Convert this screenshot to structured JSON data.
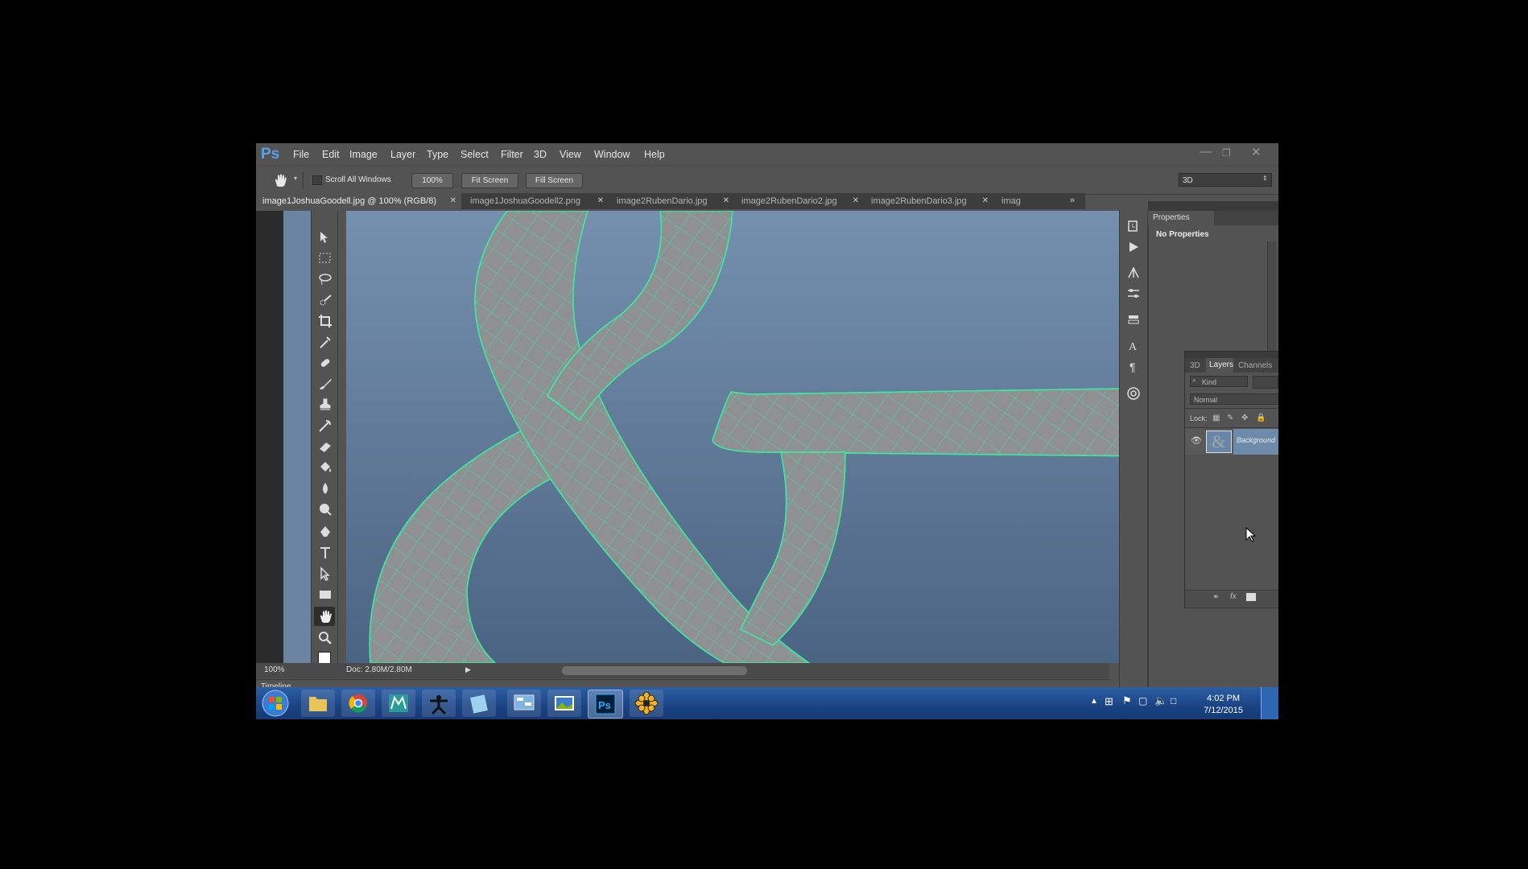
{
  "app": {
    "logo": "Ps",
    "title": "Adobe Photoshop"
  },
  "menu": [
    "File",
    "Edit",
    "Image",
    "Layer",
    "Type",
    "Select",
    "Filter",
    "3D",
    "View",
    "Window",
    "Help"
  ],
  "options_bar": {
    "scroll_all_windows": "Scroll All Windows",
    "zoom_button": "100%",
    "fit_screen": "Fit Screen",
    "fill_screen": "Fill Screen",
    "workspace": "3D"
  },
  "tabs": [
    {
      "label": "image1JoshuaGoodell.jpg @ 100% (RGB/8)",
      "active": true
    },
    {
      "label": "image1JoshuaGoodell2.png",
      "active": false
    },
    {
      "label": "image2RubenDario.jpg",
      "active": false
    },
    {
      "label": "image2RubenDario2.jpg",
      "active": false
    },
    {
      "label": "image2RubenDario3.jpg",
      "active": false
    },
    {
      "label": "imag",
      "active": false
    }
  ],
  "status": {
    "zoom": "100%",
    "doc": "Doc: 2.80M/2.80M"
  },
  "timeline": {
    "label": "Timeline"
  },
  "properties": {
    "title": "Properties",
    "content": "No Properties"
  },
  "layers_panel": {
    "tabs": [
      "3D",
      "Layers",
      "Channels"
    ],
    "filter": "Kind",
    "blend_mode": "Normal",
    "lock_label": "Lock:",
    "layer_name": "Background"
  },
  "taskbar": {
    "time": "4:02 PM",
    "date": "7/12/2015",
    "ps_icon": "Ps"
  },
  "colors": {
    "ui_bg": "#535353",
    "canvas_bg": "#6a86a6",
    "mesh": "#3ee8a0",
    "ps_blue": "#5aa2e6"
  }
}
